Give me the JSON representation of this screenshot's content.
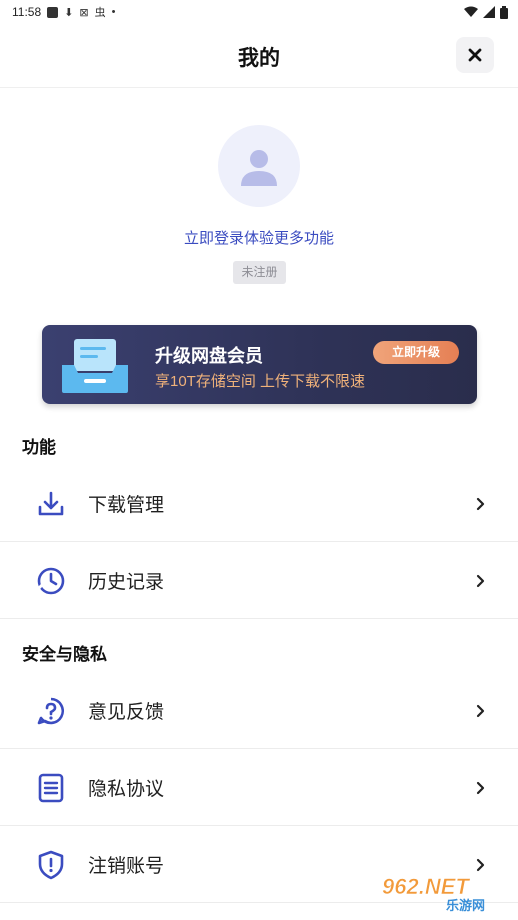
{
  "statusbar": {
    "time": "11:58",
    "glyph_a": "⬇",
    "glyph_b": "⊠",
    "glyph_c": "虫",
    "dot": "•"
  },
  "header": {
    "title": "我的",
    "close_icon": "close-icon"
  },
  "profile": {
    "login_text": "立即登录体验更多功能",
    "badge": "未注册"
  },
  "vip": {
    "title": "升级网盘会员",
    "subtitle": "享10T存储空间 上传下载不限速",
    "button": "立即升级"
  },
  "sections": {
    "features": {
      "title": "功能",
      "items": [
        {
          "label": "下载管理",
          "icon": "download-icon"
        },
        {
          "label": "历史记录",
          "icon": "clock-icon"
        }
      ]
    },
    "privacy": {
      "title": "安全与隐私",
      "items": [
        {
          "label": "意见反馈",
          "icon": "question-icon"
        },
        {
          "label": "隐私协议",
          "icon": "document-icon"
        },
        {
          "label": "注销账号",
          "icon": "shield-icon"
        }
      ]
    }
  },
  "watermark": {
    "text1": "962.NET",
    "text2": "乐游网"
  },
  "colors": {
    "accent": "#3b4cc0",
    "banner_bg": "#2f3358",
    "banner_sub": "#f0b27a",
    "upgrade_btn": "#e57f54"
  }
}
